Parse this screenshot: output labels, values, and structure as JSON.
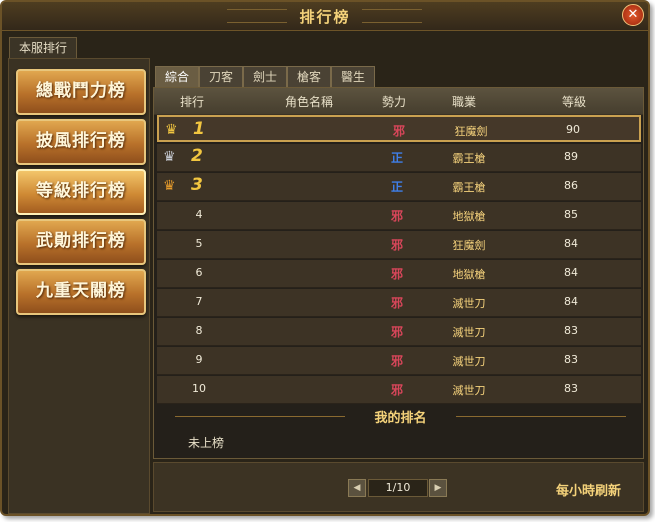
{
  "window": {
    "title": "排行榜"
  },
  "server_tab": "本服排行",
  "sidebar": {
    "items": [
      {
        "label": "總戰鬥力榜"
      },
      {
        "label": "披風排行榜"
      },
      {
        "label": "等級排行榜"
      },
      {
        "label": "武勛排行榜"
      },
      {
        "label": "九重天關榜"
      }
    ],
    "active_index": 2
  },
  "category_tabs": [
    "綜合",
    "刀客",
    "劍士",
    "槍客",
    "醫生"
  ],
  "table": {
    "headers": [
      "排行",
      "角色名稱",
      "勢力",
      "職業",
      "等級"
    ],
    "rows": [
      {
        "rank": "1",
        "crown": "gold-crown-icon",
        "faction": "邪",
        "class": "狂魔劍",
        "level": "90"
      },
      {
        "rank": "2",
        "crown": "silver-crown-icon",
        "faction": "正",
        "class": "霸王槍",
        "level": "89"
      },
      {
        "rank": "3",
        "crown": "bronze-crown-icon",
        "faction": "正",
        "class": "霸王槍",
        "level": "86"
      },
      {
        "rank": "4",
        "faction": "邪",
        "class": "地獄槍",
        "level": "85"
      },
      {
        "rank": "5",
        "faction": "邪",
        "class": "狂魔劍",
        "level": "84"
      },
      {
        "rank": "6",
        "faction": "邪",
        "class": "地獄槍",
        "level": "84"
      },
      {
        "rank": "7",
        "faction": "邪",
        "class": "滅世刀",
        "level": "84"
      },
      {
        "rank": "8",
        "faction": "邪",
        "class": "滅世刀",
        "level": "83"
      },
      {
        "rank": "9",
        "faction": "邪",
        "class": "滅世刀",
        "level": "83"
      },
      {
        "rank": "10",
        "faction": "邪",
        "class": "滅世刀",
        "level": "83"
      }
    ]
  },
  "my_rank": {
    "label": "我的排名",
    "value": "未上榜"
  },
  "pager": {
    "text": "1/10",
    "prev": "◀",
    "next": "▶"
  },
  "refresh_label": "每小時刷新",
  "colors": {
    "evil": "#d8465a",
    "good": "#3f7fe8",
    "gold": "#f2c640",
    "silver": "#c8ccd4",
    "bronze": "#e59b2c"
  }
}
